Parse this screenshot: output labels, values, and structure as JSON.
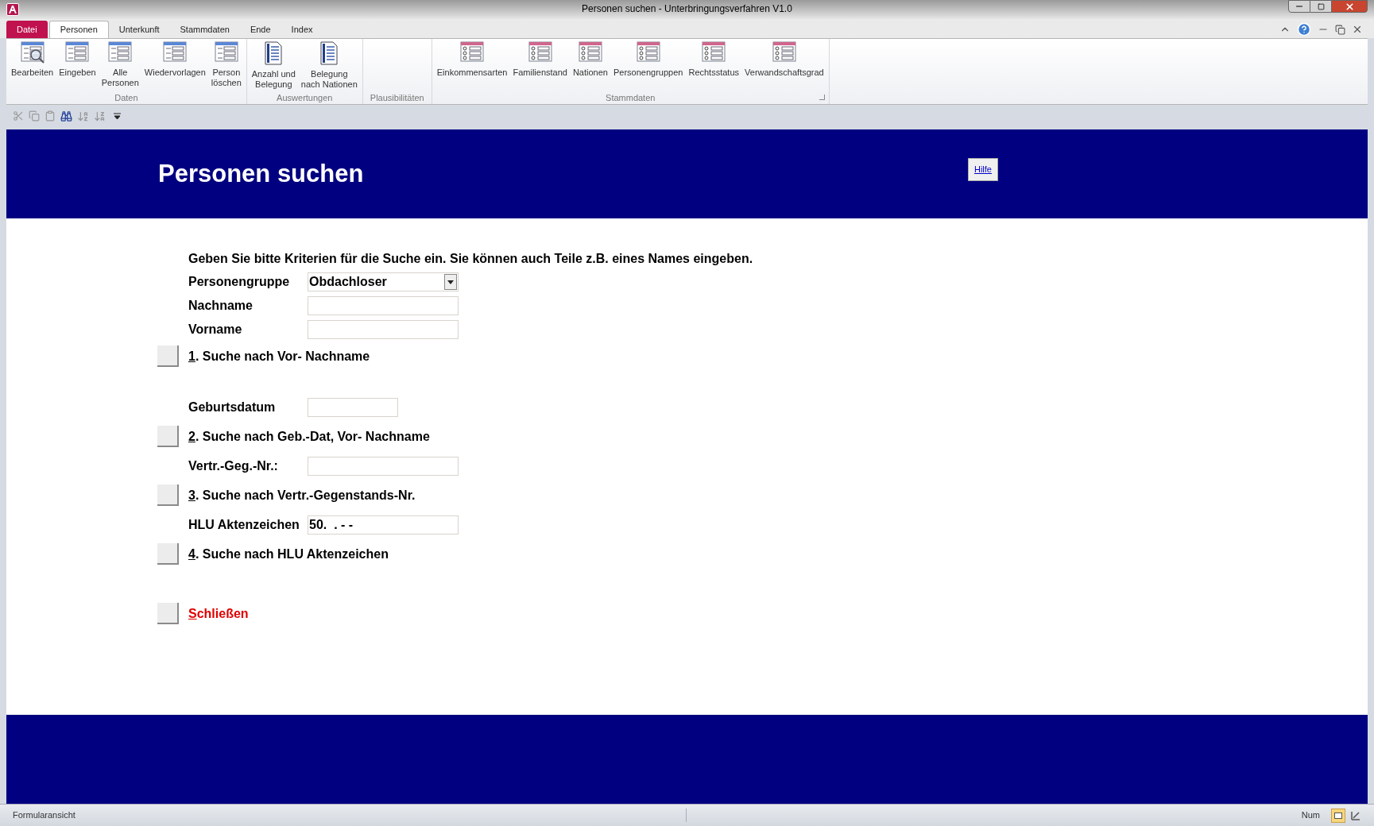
{
  "window": {
    "title": "Personen suchen  -  Unterbringungsverfahren V1.0"
  },
  "tabs": [
    {
      "label": "Datei",
      "kind": "file",
      "selected": false
    },
    {
      "label": "Personen",
      "kind": "tab",
      "selected": true
    },
    {
      "label": "Unterkunft",
      "kind": "tab",
      "selected": false
    },
    {
      "label": "Stammdaten",
      "kind": "tab",
      "selected": false
    },
    {
      "label": "Ende",
      "kind": "tab",
      "selected": false
    },
    {
      "label": "Index",
      "kind": "tab",
      "selected": false
    }
  ],
  "ribbon_groups": [
    {
      "label": "Daten",
      "buttons": [
        {
          "label": "Bearbeiten",
          "kind": "search_table"
        },
        {
          "label": "Eingeben",
          "kind": "table"
        },
        {
          "label": "Alle\nPersonen",
          "kind": "table"
        },
        {
          "label": "Wiedervorlagen",
          "kind": "table"
        },
        {
          "label": "Person\nlöschen",
          "kind": "table"
        }
      ]
    },
    {
      "label": "Auswertungen",
      "buttons": [
        {
          "label": "Anzahl und\nBelegung",
          "kind": "report"
        },
        {
          "label": "Belegung\nnach Nationen",
          "kind": "report"
        }
      ]
    },
    {
      "label": "Plausibilitäten"
    },
    {
      "label": "Stammdaten",
      "launcher": true,
      "buttons": [
        {
          "label": "Einkommensarten",
          "kind": "people_table"
        },
        {
          "label": "Familienstand",
          "kind": "people_table"
        },
        {
          "label": "Nationen",
          "kind": "people_table"
        },
        {
          "label": "Personengruppen",
          "kind": "people_table"
        },
        {
          "label": "Rechtsstatus",
          "kind": "people_table"
        },
        {
          "label": "Verwandschaftsgrad",
          "kind": "people_table"
        }
      ]
    }
  ],
  "header": {
    "title": "Personen suchen",
    "help_button": "Hilfe"
  },
  "form": {
    "intro": "Geben Sie bitte Kriterien für die Suche ein. Sie können auch Teile z.B. eines Names eingeben.",
    "items": [
      {
        "kind": "dropdown",
        "label": "Personengruppe",
        "value": "Obdachloser"
      },
      {
        "kind": "field",
        "label": "Nachname",
        "value": ""
      },
      {
        "kind": "field",
        "label": "Vorname",
        "value": ""
      },
      {
        "kind": "search",
        "key": "1",
        "label": ". Suche nach Vor- Nachname"
      },
      {
        "kind": "spacer"
      },
      {
        "kind": "short_field",
        "label": "Geburtsdatum",
        "value": ""
      },
      {
        "kind": "search",
        "key": "2",
        "label": ". Suche nach Geb.-Dat, Vor- Nachname"
      },
      {
        "kind": "field",
        "label": "Vertr.-Geg.-Nr.:",
        "value": ""
      },
      {
        "kind": "search",
        "key": "3",
        "label": ". Suche nach Vertr.-Gegenstands-Nr."
      },
      {
        "kind": "field",
        "label": "HLU Aktenzeichen",
        "value": "50.  . - -"
      },
      {
        "kind": "search",
        "key": "4",
        "label": ". Suche nach HLU Aktenzeichen"
      },
      {
        "kind": "spacer"
      },
      {
        "kind": "close",
        "key": "S",
        "label": "chließen"
      }
    ]
  },
  "status_bar": {
    "view": "Formularansicht",
    "indicator": "Num"
  }
}
